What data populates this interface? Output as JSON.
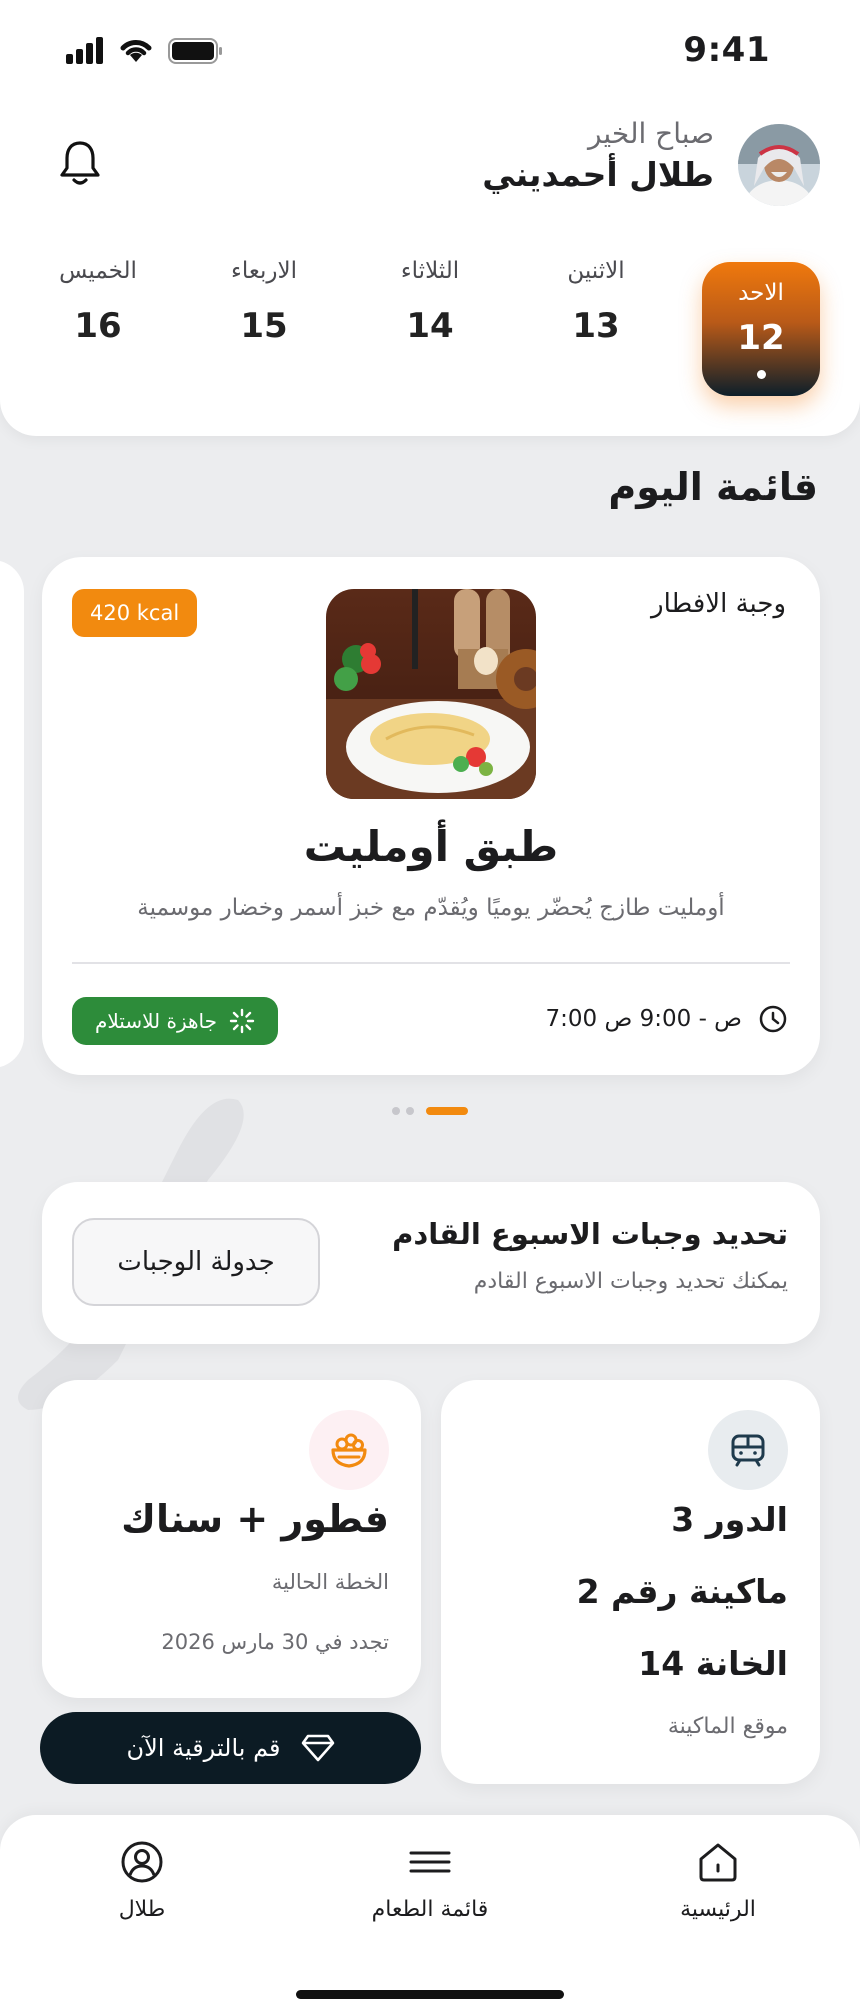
{
  "status_bar": {
    "time": "9:41"
  },
  "header": {
    "greeting": "صباح الخير",
    "user_name": "طلال أحمديني"
  },
  "week_days": [
    {
      "name": "الاحد",
      "date": "12",
      "selected": true
    },
    {
      "name": "الاثنين",
      "date": "13",
      "selected": false
    },
    {
      "name": "الثلاثاء",
      "date": "14",
      "selected": false
    },
    {
      "name": "الاربعاء",
      "date": "15",
      "selected": false
    },
    {
      "name": "الخميس",
      "date": "16",
      "selected": false
    }
  ],
  "today_menu": {
    "title": "قائمة اليوم",
    "meal": {
      "type": "وجبة الافطار",
      "kcal": "420 kcal",
      "name": "طبق أومليت",
      "description": "أومليت طازج يُحضّر يوميًا ويُقدّم مع خبز أسمر وخضار موسمية",
      "time_range": "7:00 ص - 9:00 ص",
      "status": "جاهزة للاستلام"
    },
    "pager": {
      "count": 3,
      "active": 0
    }
  },
  "plan_next_week": {
    "title": "تحديد وجبات الاسبوع القادم",
    "subtitle": "يمكنك تحديد وجبات الاسبوع القادم",
    "button": "جدولة الوجبات"
  },
  "machine": {
    "floor": "الدور 3",
    "machine_no": "ماكينة رقم 2",
    "slot": "الخانة 14",
    "label": "موقع الماكينة"
  },
  "subscription": {
    "plan_name": "فطور + سناك",
    "current_label": "الخطة الحالية",
    "renewal": "تجدد في 30 مارس 2026",
    "upgrade_button": "قم بالترقية الآن"
  },
  "bottom_nav": {
    "home": "الرئيسية",
    "menu": "قائمة الطعام",
    "profile": "طلال"
  },
  "colors": {
    "accent": "#f28a0f",
    "dark": "#0c1b24",
    "success": "#2d8c3a",
    "background": "#ecedef"
  },
  "icons": [
    "bell-icon",
    "clock-icon",
    "spinner-icon",
    "machine-icon",
    "food-bowl-icon",
    "diamond-icon",
    "home-icon",
    "menu-icon",
    "user-icon"
  ]
}
